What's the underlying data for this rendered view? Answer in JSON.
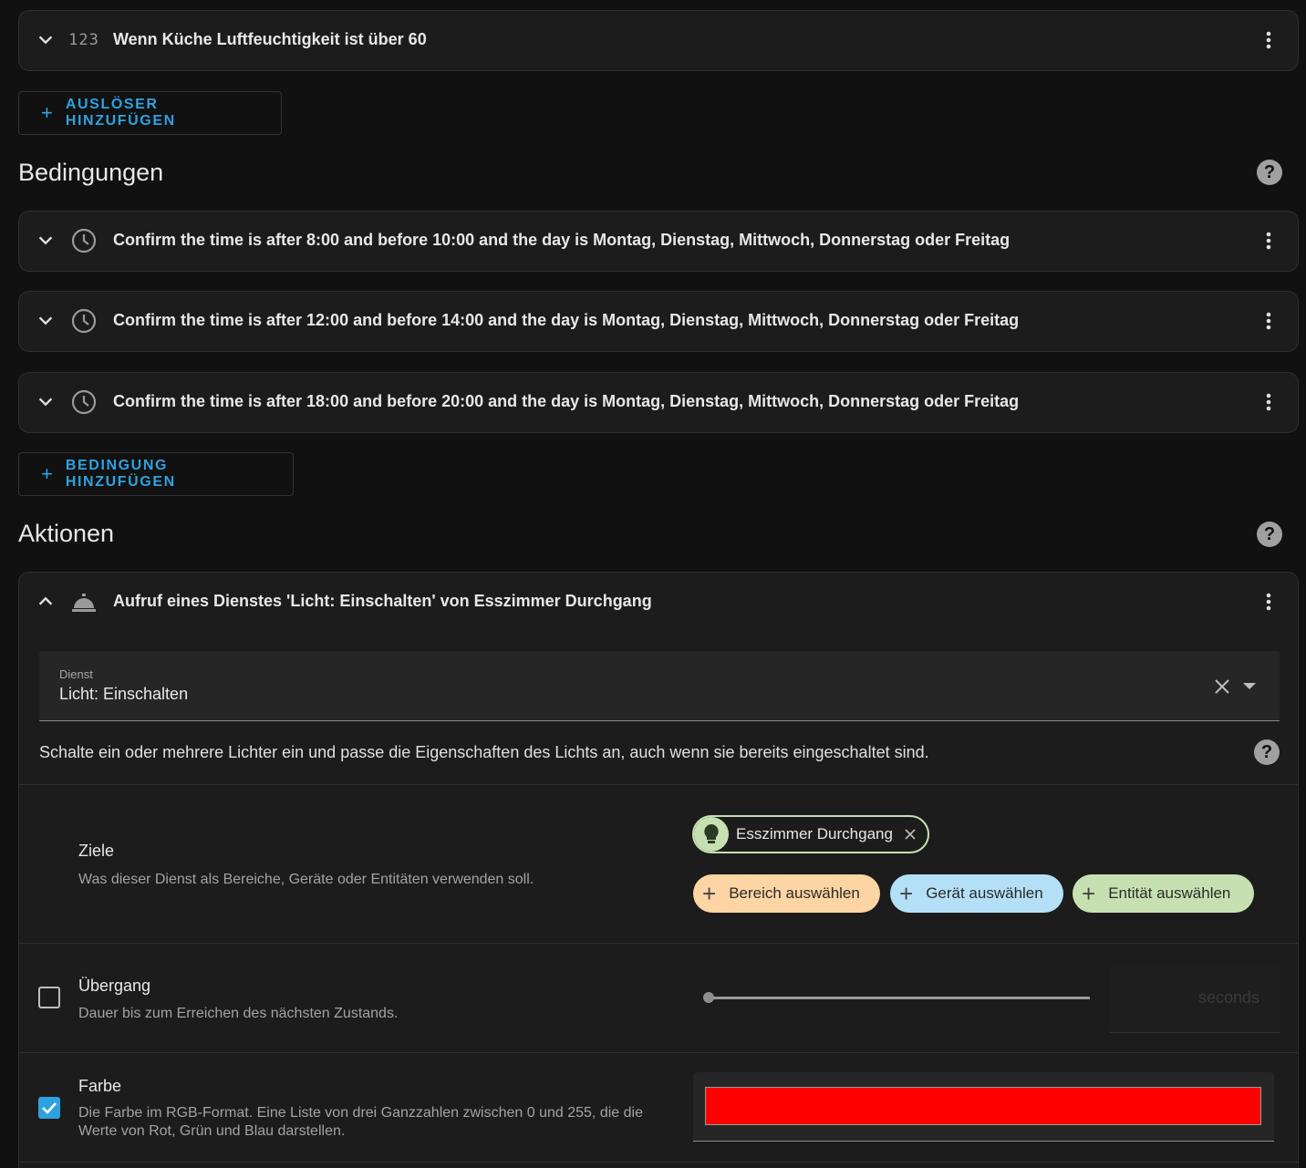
{
  "trigger": {
    "title": "Wenn Küche Luftfeuchtigkeit ist über 60",
    "icon_text": "123",
    "add_label": "AUSLÖSER HINZUFÜGEN"
  },
  "conditions": {
    "heading": "Bedingungen",
    "help": "?",
    "items": [
      {
        "title": "Confirm the time is after 8:00 and before 10:00 and the day is Montag, Dienstag, Mittwoch, Donnerstag oder Freitag"
      },
      {
        "title": "Confirm the time is after 12:00 and before 14:00 and the day is Montag, Dienstag, Mittwoch, Donnerstag oder Freitag"
      },
      {
        "title": "Confirm the time is after 18:00 and before 20:00 and the day is Montag, Dienstag, Mittwoch, Donnerstag oder Freitag"
      }
    ],
    "add_label": "BEDINGUNG HINZUFÜGEN"
  },
  "actions": {
    "heading": "Aktionen",
    "help": "?",
    "item": {
      "title": "Aufruf eines Dienstes 'Licht: Einschalten' von Esszimmer Durchgang",
      "service": {
        "label": "Dienst",
        "value": "Licht: Einschalten",
        "description": "Schalte ein oder mehrere Lichter ein und passe die Eigenschaften des Lichts an, auch wenn sie bereits eingeschaltet sind."
      },
      "targets": {
        "title": "Ziele",
        "description": "Was dieser Dienst als Bereiche, Geräte oder Entitäten verwenden soll.",
        "selected_entity": "Esszimmer Durchgang",
        "area_button": "Bereich auswählen",
        "device_button": "Gerät auswählen",
        "entity_button": "Entität auswählen",
        "colors": {
          "area": "#fdd4a3",
          "device": "#b3e0f7",
          "entity": "#c7e0b1"
        }
      },
      "transition": {
        "title": "Übergang",
        "description": "Dauer bis zum Erreichen des nächsten Zustands.",
        "enabled": false,
        "slider_value": 0,
        "unit": "seconds"
      },
      "color": {
        "title": "Farbe",
        "description": "Die Farbe im RGB-Format. Eine Liste von drei Ganzzahlen zwischen 0 und 255, die die Werte von Rot, Grün und Blau darstellen.",
        "enabled": true,
        "value": "#ff0000"
      }
    }
  },
  "theme": {
    "accent": "#2ea2e0",
    "background": "#111111",
    "card": "#1c1c1c"
  }
}
